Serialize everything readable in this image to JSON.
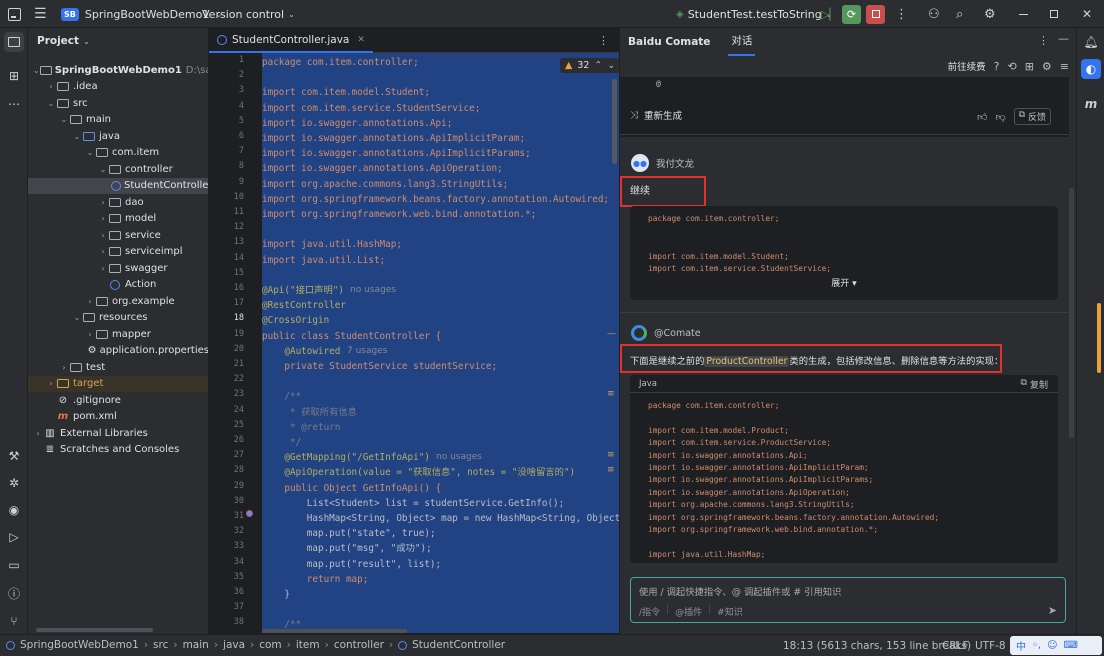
{
  "titlebar": {
    "project_badge": "SB",
    "project_name": "SpringBootWebDemo1",
    "vcs": "Version control",
    "run_config": "StudentTest.testToString"
  },
  "left_toolbar": [
    "project-icon",
    "structure-icon",
    "more-icon",
    "build-icon",
    "debug-icon",
    "services-icon",
    "run-icon",
    "terminal-icon",
    "problems-icon",
    "git-icon"
  ],
  "project": {
    "header": "Project",
    "tree": [
      {
        "label": "SpringBootWebDemo1",
        "extra": "D:\\save\\sto",
        "depth": 0,
        "arrow": "v",
        "icon": "folder",
        "bold": true
      },
      {
        "label": ".idea",
        "depth": 1,
        "arrow": ">",
        "icon": "folder"
      },
      {
        "label": "src",
        "depth": 1,
        "arrow": "v",
        "icon": "folder"
      },
      {
        "label": "main",
        "depth": 2,
        "arrow": "v",
        "icon": "folder"
      },
      {
        "label": "java",
        "depth": 3,
        "arrow": "v",
        "icon": "folder-blue"
      },
      {
        "label": "com.item",
        "depth": 4,
        "arrow": "v",
        "icon": "folder"
      },
      {
        "label": "controller",
        "depth": 5,
        "arrow": "v",
        "icon": "folder"
      },
      {
        "label": "StudentController",
        "depth": 6,
        "arrow": "",
        "icon": "class",
        "selected": true
      },
      {
        "label": "dao",
        "depth": 5,
        "arrow": ">",
        "icon": "folder"
      },
      {
        "label": "model",
        "depth": 5,
        "arrow": ">",
        "icon": "folder"
      },
      {
        "label": "service",
        "depth": 5,
        "arrow": ">",
        "icon": "folder"
      },
      {
        "label": "serviceimpl",
        "depth": 5,
        "arrow": ">",
        "icon": "folder"
      },
      {
        "label": "swagger",
        "depth": 5,
        "arrow": ">",
        "icon": "folder"
      },
      {
        "label": "Action",
        "depth": 5,
        "arrow": "",
        "icon": "class-plain"
      },
      {
        "label": "org.example",
        "depth": 4,
        "arrow": ">",
        "icon": "folder"
      },
      {
        "label": "resources",
        "depth": 3,
        "arrow": "v",
        "icon": "folder"
      },
      {
        "label": "mapper",
        "depth": 4,
        "arrow": ">",
        "icon": "folder"
      },
      {
        "label": "application.properties",
        "depth": 4,
        "arrow": "",
        "icon": "gear"
      },
      {
        "label": "test",
        "depth": 2,
        "arrow": ">",
        "icon": "folder"
      },
      {
        "label": "target",
        "depth": 1,
        "arrow": ">",
        "icon": "folder-orange",
        "highlight": true
      },
      {
        "label": ".gitignore",
        "depth": 1,
        "arrow": "",
        "icon": "ignore"
      },
      {
        "label": "pom.xml",
        "depth": 1,
        "arrow": "",
        "icon": "maven"
      },
      {
        "label": "External Libraries",
        "depth": 0,
        "arrow": ">",
        "icon": "lib"
      },
      {
        "label": "Scratches and Consoles",
        "depth": 0,
        "arrow": "",
        "icon": "scratch"
      }
    ]
  },
  "editor": {
    "tab_label": "StudentController.java",
    "warnings": "32",
    "line_numbers": [
      "1",
      "2",
      "3",
      "4",
      "5",
      "6",
      "7",
      "8",
      "9",
      "10",
      "11",
      "12",
      "13",
      "14",
      "15",
      "16",
      "17",
      "18",
      "19",
      "20",
      "21",
      "22",
      "23",
      "24",
      "25",
      "26",
      "27",
      "28",
      "29",
      "30",
      "31",
      "32",
      "33",
      "34",
      "35",
      "36",
      "37",
      "38"
    ],
    "lines": [
      "package com.item.controller;",
      "",
      "import com.item.model.Student;",
      "import com.item.service.StudentService;",
      "import io.swagger.annotations.Api;",
      "import io.swagger.annotations.ApiImplicitParam;",
      "import io.swagger.annotations.ApiImplicitParams;",
      "import io.swagger.annotations.ApiOperation;",
      "import org.apache.commons.lang3.StringUtils;",
      "import org.springframework.beans.factory.annotation.Autowired;",
      "import org.springframework.web.bind.annotation.*;",
      "",
      "import java.util.HashMap;",
      "import java.util.List;",
      "",
      "@Api(\"接口声明\")",
      "@RestController",
      "@CrossOrigin",
      "public class StudentController {",
      "    @Autowired",
      "    private StudentService studentService;",
      "",
      "    /**",
      "     * 获取所有信息",
      "     * @return",
      "     */",
      "    @GetMapping(\"/GetInfoApi\")",
      "    @ApiOperation(value = \"获取信息\", notes = \"没啥留言的\")",
      "    public Object GetInfoApi() {",
      "        List<Student> list = studentService.GetInfo();",
      "        HashMap<String, Object> map = new HashMap<String, Object>",
      "        map.put(\"state\", true);",
      "        map.put(\"msg\", \"成功\");",
      "        map.put(\"result\", list);",
      "        return map;",
      "    }",
      "",
      "    /**"
    ],
    "hints": {
      "api_usages": "no usages",
      "autowired_usages": "7 usages",
      "getmapping_usages": "no usages"
    }
  },
  "comate": {
    "title": "Baidu Comate",
    "tab": "对话",
    "toolbar_label": "前往续费",
    "regenerate": "重新生成",
    "feedback": "反馈",
    "user_name": "我付文龙",
    "user_message": "继续",
    "user_code": [
      "package com.item.controller;",
      "",
      "",
      "import com.item.model.Student;",
      "import com.item.service.StudentService;"
    ],
    "expand": "展开",
    "bot_name": "@Comate",
    "bot_message_pre": "下面是继续之前的",
    "bot_message_code": "ProductController",
    "bot_message_post": "类的生成，包括修改信息、删除信息等方法的实现：",
    "code_lang": "Java",
    "copy": "复制",
    "bot_code": [
      "package com.item.controller;",
      "",
      "import com.item.model.Product;",
      "import com.item.service.ProductService;",
      "import io.swagger.annotations.Api;",
      "import io.swagger.annotations.ApiImplicitParam;",
      "import io.swagger.annotations.ApiImplicitParams;",
      "import io.swagger.annotations.ApiOperation;",
      "import org.apache.commons.lang3.StringUtils;",
      "import org.springframework.beans.factory.annotation.Autowired;",
      "import org.springframework.web.bind.annotation.*;",
      "",
      "import java.util.HashMap;"
    ],
    "input_placeholder": "使用 / 调起快捷指令、@ 调起插件或 # 引用知识",
    "input_actions": [
      "/指令",
      "@插件",
      "#知识"
    ]
  },
  "statusbar": {
    "breadcrumb": [
      "SpringBootWebDemo1",
      "src",
      "main",
      "java",
      "com",
      "item",
      "controller",
      "StudentController"
    ],
    "position": "18:13 (5613 chars, 153 line breaks)",
    "line_sep": "CRLF",
    "encoding": "UTF-8",
    "ime": "中"
  },
  "colors": {
    "accent": "#3574f0",
    "selection": "#214283",
    "annotation_red": "#e03030",
    "run_green": "#57965c",
    "stop_red": "#c94f4f"
  }
}
